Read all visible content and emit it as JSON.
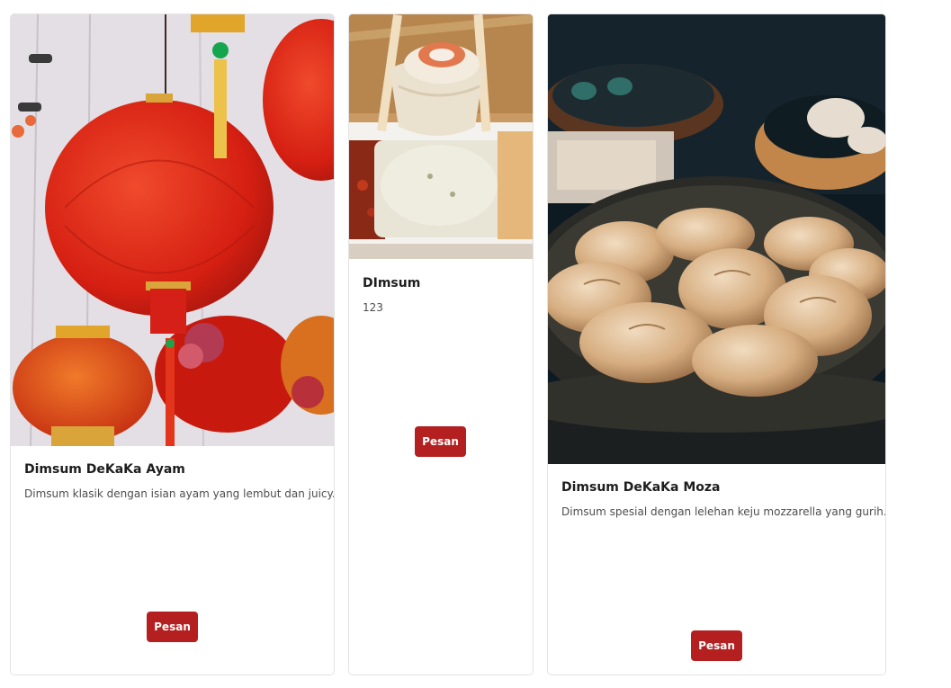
{
  "products": [
    {
      "name": "Dimsum DeKaKa Ayam",
      "description": "Dimsum klasik dengan isian ayam yang lembut dan juicy.",
      "button_label": "Pesan",
      "image_subject": "red-lanterns-image"
    },
    {
      "name": "DImsum",
      "description": "123",
      "button_label": "Pesan",
      "image_subject": "dimsum-chopsticks-sauce-image"
    },
    {
      "name": "Dimsum DeKaKa Moza",
      "description": "Dimsum spesial dengan lelehan keju mozzarella yang gurih.",
      "button_label": "Pesan",
      "image_subject": "steamed-dumplings-image"
    }
  ],
  "colors": {
    "button": "#b3201f",
    "border": "#e3e3e3"
  }
}
